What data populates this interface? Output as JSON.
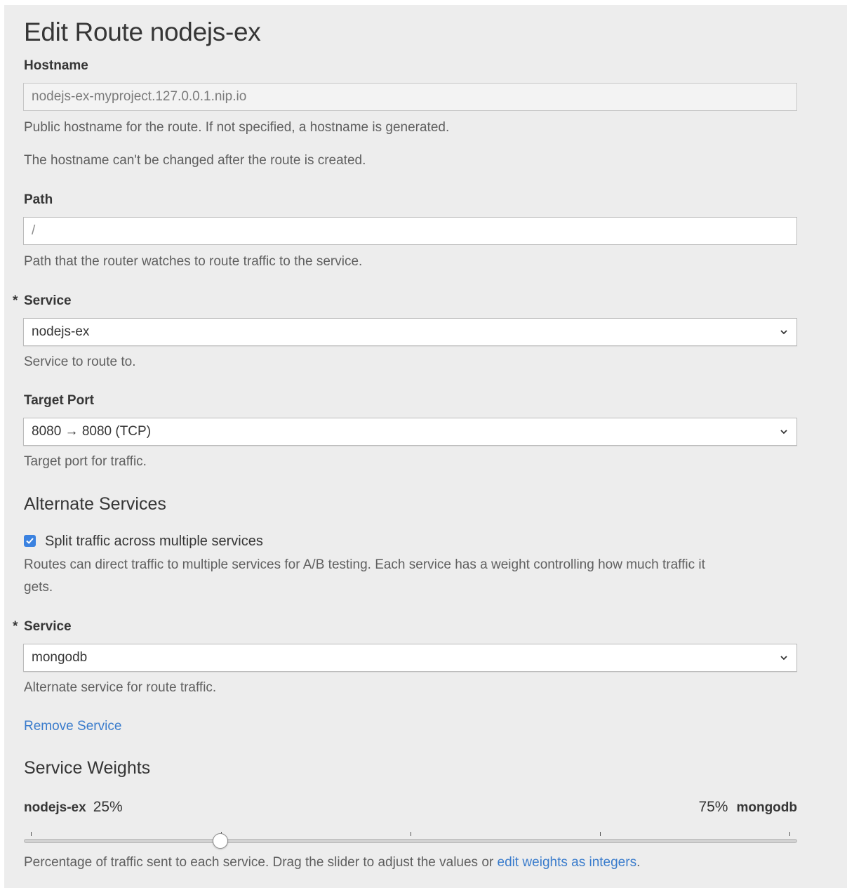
{
  "title": "Edit Route nodejs-ex",
  "hostname": {
    "label": "Hostname",
    "value": "nodejs-ex-myproject.127.0.0.1.nip.io",
    "help1": "Public hostname for the route. If not specified, a hostname is generated.",
    "help2": "The hostname can't be changed after the route is created."
  },
  "path": {
    "label": "Path",
    "value": "/",
    "help": "Path that the router watches to route traffic to the service."
  },
  "service": {
    "required_mark": "*",
    "label": "Service",
    "selected": "nodejs-ex",
    "help": "Service to route to."
  },
  "target_port": {
    "label": "Target Port",
    "selected": "8080 → 8080 (TCP)",
    "help": "Target port for traffic."
  },
  "alternate": {
    "heading": "Alternate Services",
    "split_checked": true,
    "split_label": "Split traffic across multiple services",
    "help_line1": "Routes can direct traffic to multiple services for A/B testing. Each service has a weight controlling how much traffic it",
    "help_line2": "gets.",
    "service_required_mark": "*",
    "service_label": "Service",
    "service_selected": "mongodb",
    "service_help": "Alternate service for route traffic.",
    "remove_label": "Remove Service"
  },
  "weights": {
    "heading": "Service Weights",
    "left_name": "nodejs-ex",
    "left_pct": "25%",
    "right_pct": "75%",
    "right_name": "mongodb",
    "slider_value": 0.25,
    "help_prefix": "Percentage of traffic sent to each service. Drag the slider to adjust the values or ",
    "help_link": "edit weights as integers",
    "help_suffix": "."
  },
  "colors": {
    "background": "#ededed",
    "link": "#3a7ccc",
    "checkbox": "#3b82e0"
  }
}
